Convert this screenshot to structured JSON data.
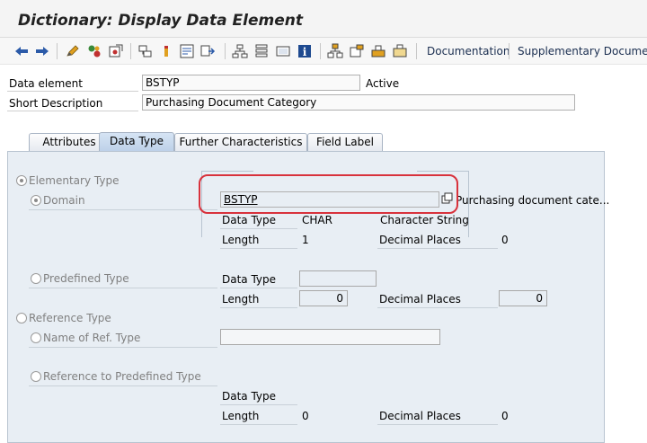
{
  "window": {
    "title": "Dictionary: Display Data Element"
  },
  "toolbar": {
    "icons": [
      "back-arrow-icon",
      "forward-arrow-icon",
      "edit-pencil-icon",
      "display-change-icon",
      "check-icon",
      "activate-icon",
      "where-used-icon",
      "navigate-icon",
      "object-list-icon",
      "hierarchy-icon",
      "stack-icon",
      "screen-icon",
      "info-icon",
      "tree-icon",
      "folder-icon",
      "transport-icon",
      "window-icon"
    ],
    "documentation_label": "Documentation",
    "supplementary_label": "Supplementary Documentat"
  },
  "header": {
    "data_element_label": "Data element",
    "data_element_value": "BSTYP",
    "status": "Active",
    "short_description_label": "Short Description",
    "short_description_value": "Purchasing Document Category"
  },
  "tabs": [
    {
      "label": "Attributes"
    },
    {
      "label": "Data Type",
      "active": true
    },
    {
      "label": "Further Characteristics"
    },
    {
      "label": "Field Label"
    }
  ],
  "elementary": {
    "label": "Elementary Type",
    "domain_label": "Domain",
    "domain_value": "BSTYP",
    "domain_description": "Purchasing document cate...",
    "data_type_label": "Data Type",
    "data_type_value": "CHAR",
    "data_type_desc": "Character String",
    "length_label": "Length",
    "length_value": "1",
    "decimal_places_label": "Decimal Places",
    "decimal_places_value": "0"
  },
  "predefined": {
    "label": "Predefined Type",
    "data_type_label": "Data Type",
    "data_type_value": "",
    "length_label": "Length",
    "length_value": "0",
    "decimal_places_label": "Decimal Places",
    "decimal_places_value": "0"
  },
  "reference": {
    "label": "Reference Type",
    "name_label": "Name of Ref. Type",
    "name_value": "",
    "predef_label": "Reference to Predefined Type",
    "data_type_label": "Data Type",
    "length_label": "Length",
    "length_value": "0",
    "decimal_places_label": "Decimal Places",
    "decimal_places_value": "0"
  },
  "colors": {
    "highlight": "#d8323c",
    "panel": "#e8eef4",
    "toolbar_text": "#1a2e50"
  }
}
